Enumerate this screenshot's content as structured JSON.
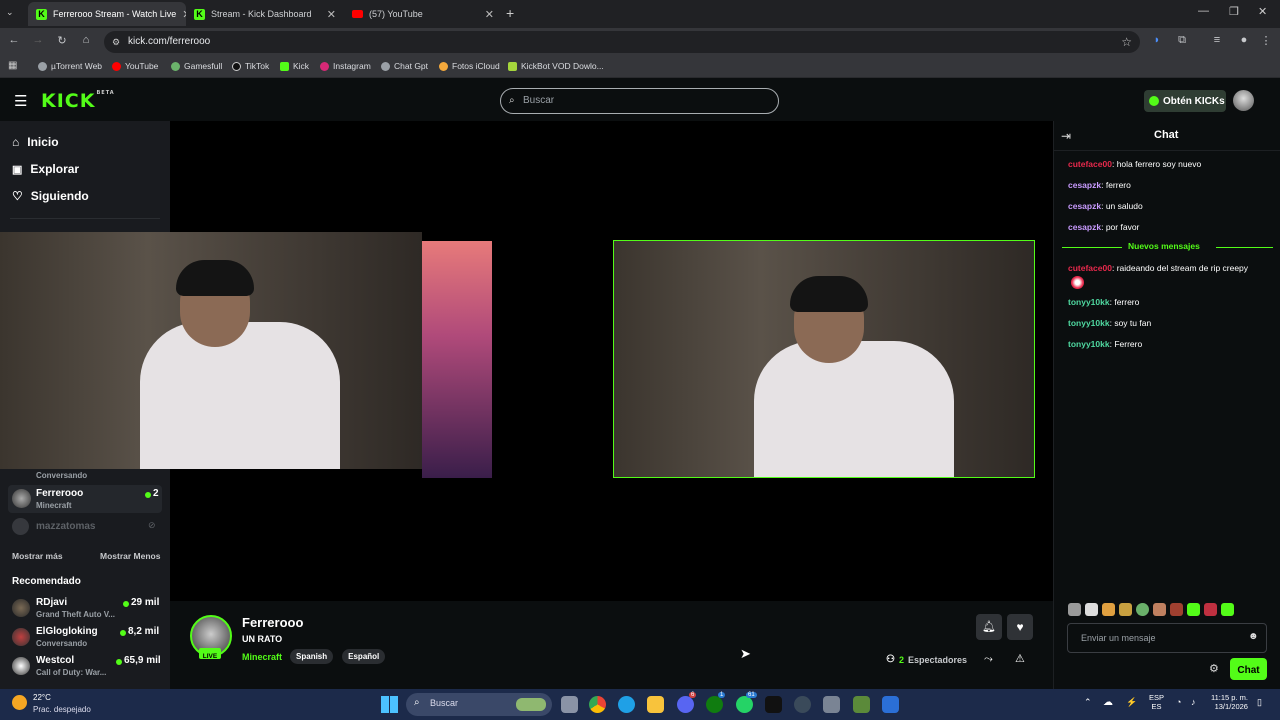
{
  "browser": {
    "tabs": [
      {
        "title": "Ferrerooo Stream - Watch Live",
        "active": true
      },
      {
        "title": "Stream - Kick Dashboard",
        "active": false
      },
      {
        "title": "(57) YouTube",
        "active": false
      }
    ],
    "url": "kick.com/ferrerooo",
    "bookmarks": [
      "µTorrent Web",
      "YouTube",
      "Gamesfull",
      "TikTok",
      "Kick",
      "Instagram",
      "Chat Gpt",
      "Fotos iCloud",
      "KickBot VOD Dowlo..."
    ]
  },
  "kick": {
    "logo": "KICK",
    "logo_badge": "BETA",
    "search_placeholder": "Buscar",
    "kicks_button": "Obtén KICKs",
    "nav": [
      "Inicio",
      "Explorar",
      "Siguiendo"
    ]
  },
  "sidebar": {
    "following_partial_sub": "Conversando",
    "following": [
      {
        "name": "Ferrerooo",
        "category": "Minecraft",
        "viewers": "2",
        "live": true
      },
      {
        "name": "mazzatomas",
        "category": "",
        "viewers": "",
        "live": false
      }
    ],
    "show_more": "Mostrar más",
    "show_less": "Mostrar Menos",
    "recommended_title": "Recomendado",
    "recommended": [
      {
        "name": "RDjavi",
        "category": "Grand Theft Auto V...",
        "viewers": "29 mil"
      },
      {
        "name": "ElGlogloking",
        "category": "Conversando",
        "viewers": "8,2 mil"
      },
      {
        "name": "Westcol",
        "category": "Call of Duty: War...",
        "viewers": "65,9 mil"
      }
    ]
  },
  "stream": {
    "streamer": "Ferrerooo",
    "live_badge": "LIVE",
    "title": "UN RATO",
    "category": "Minecraft",
    "tags": [
      "Spanish",
      "Español"
    ],
    "viewers_count": "2",
    "viewers_label": "Espectadores"
  },
  "chat": {
    "title": "Chat",
    "messages_before": [
      {
        "user": "cuteface00",
        "color": "#e8294c",
        "text": "hola ferrero soy nuevo"
      },
      {
        "user": "cesapzk",
        "color": "#c99bff",
        "text": "ferrero"
      },
      {
        "user": "cesapzk",
        "color": "#c99bff",
        "text": "un saludo"
      },
      {
        "user": "cesapzk",
        "color": "#c99bff",
        "text": "por favor"
      }
    ],
    "new_messages_divider": "Nuevos mensajes",
    "messages_after": [
      {
        "user": "cuteface00",
        "color": "#e8294c",
        "text": "raideando del stream de rip creepy"
      },
      {
        "user": "tonyy10kk",
        "color": "#4fd8a0",
        "text": "ferrero"
      },
      {
        "user": "tonyy10kk",
        "color": "#4fd8a0",
        "text": "soy tu fan"
      },
      {
        "user": "tonyy10kk",
        "color": "#4fd8a0",
        "text": "Ferrero"
      }
    ],
    "input_placeholder": "Enviar un mensaje",
    "send_button": "Chat"
  },
  "taskbar": {
    "weather_temp": "22°C",
    "weather_desc": "Prac. despejado",
    "search_label": "Buscar",
    "lang_top": "ESP",
    "lang_bottom": "ES",
    "time": "11:15 p. m.",
    "date": "13/1/2026",
    "badges": [
      "6",
      "1",
      "61"
    ]
  },
  "colors": {
    "kick_green": "#53fc18",
    "chat_divider": "#53fc18"
  }
}
